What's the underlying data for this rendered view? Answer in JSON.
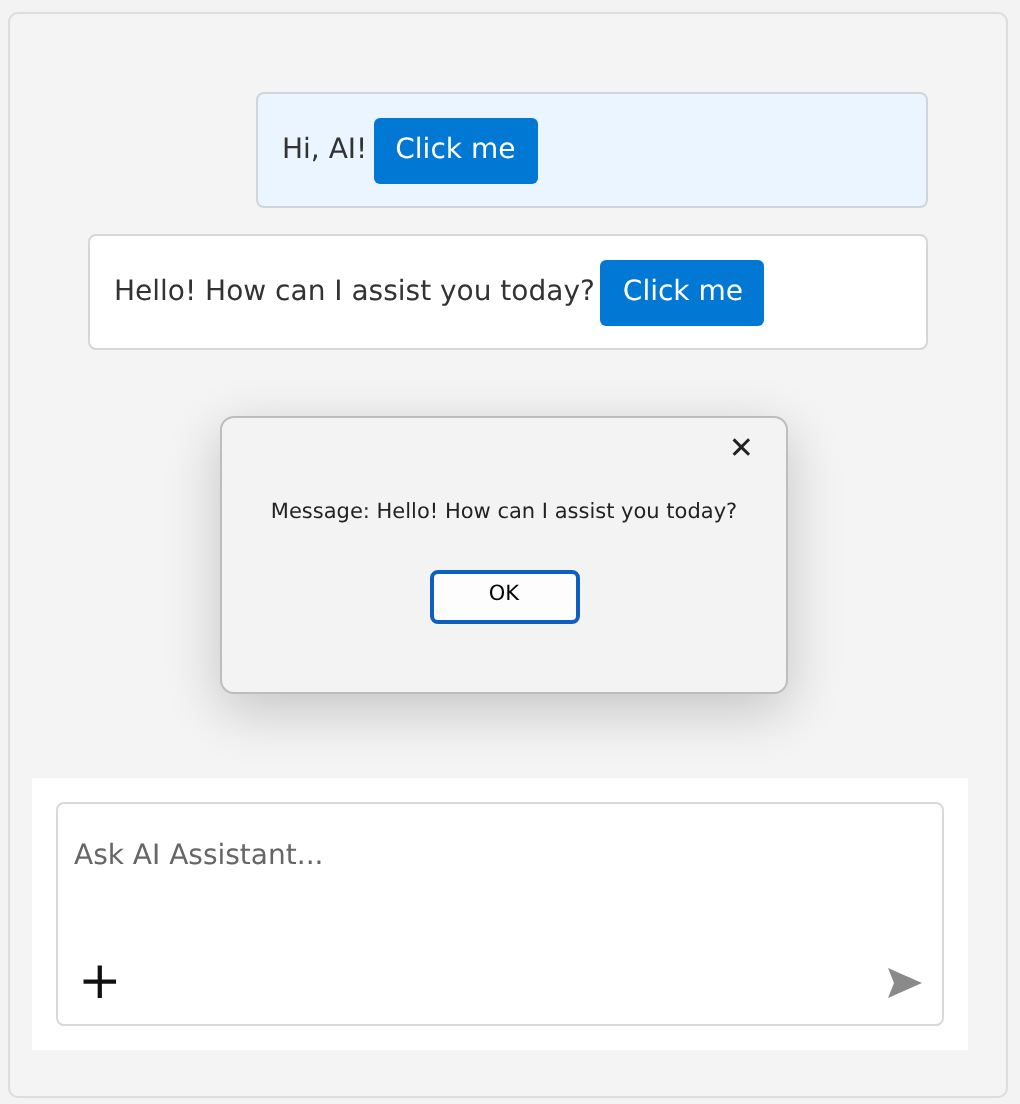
{
  "messages": [
    {
      "kind": "user",
      "text": "Hi, AI!",
      "button": "Click me"
    },
    {
      "kind": "bot",
      "text": "Hello! How can I assist you today?",
      "button": "Click me"
    }
  ],
  "dialog": {
    "close": "✕",
    "message": "Message: Hello! How can I assist you today?",
    "button": "OK"
  },
  "composer": {
    "placeholder": "Ask AI Assistant...",
    "add": "+"
  }
}
